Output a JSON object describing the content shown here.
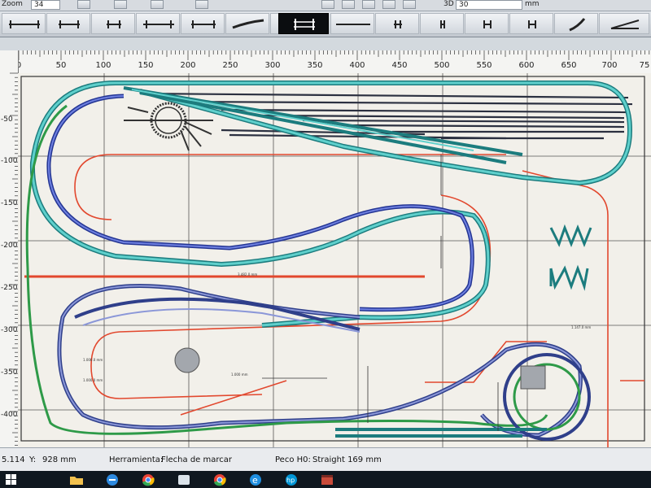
{
  "topbar": {
    "zoom_label": "Zoom",
    "zoom_value": "34",
    "view_mode": "3D",
    "view_value": "30",
    "unit": "mm"
  },
  "ruler": {
    "h_labels": [
      "0",
      "50",
      "100",
      "150",
      "200",
      "250",
      "300",
      "350",
      "400",
      "450",
      "500",
      "550",
      "600",
      "650",
      "700",
      "75"
    ],
    "v_labels": [
      "-50",
      "-100",
      "-150",
      "-200",
      "-250",
      "-300",
      "-350",
      "-400"
    ]
  },
  "canvas": {
    "dimensions": [
      "3.482.0 mm",
      "1.000.0 mm",
      "1.000.0 mm",
      "1.147.0 mm",
      "1.000 mm"
    ],
    "colors": {
      "background": "#f2f0ea",
      "teal": "#2aa3a5",
      "blue": "#3a4fb3",
      "navy": "#2f3f8a",
      "green": "#2e9a48",
      "red": "#e2482e",
      "grid": "#555555"
    }
  },
  "status": {
    "x_value": "5.114",
    "y_label": "Y:",
    "y_value": "928 mm",
    "tool_label": "Herramienta:",
    "tool_value": "Flecha de marcar",
    "track_label": "Peco H0:",
    "track_value": "Straight 169 mm"
  },
  "toolbar": {
    "tools": [
      "straight-track-icon",
      "track-segment-icon",
      "track-segment-icon",
      "double-track-icon",
      "track-segment-icon",
      "curved-track-icon",
      "track-segment-icon",
      "track-selected-icon",
      "track-long-icon",
      "track-segment-icon",
      "track-segment-icon",
      "track-segment-icon",
      "curve-track-icon",
      "turnout-icon"
    ]
  },
  "taskbar": {
    "apps": [
      "windows-start-icon",
      "folder-icon",
      "edge-icon",
      "chrome-icon",
      "ie-icon",
      "hp-icon",
      "app-icon"
    ]
  }
}
